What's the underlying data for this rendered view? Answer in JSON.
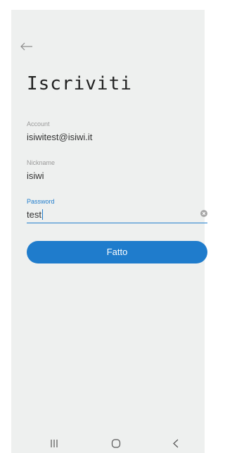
{
  "page": {
    "title": "Iscriviti"
  },
  "fields": {
    "account": {
      "label": "Account",
      "value": "isiwitest@isiwi.it"
    },
    "nickname": {
      "label": "Nickname",
      "value": "isiwi"
    },
    "password": {
      "label": "Password",
      "value": "test"
    }
  },
  "actions": {
    "done_label": "Fatto"
  },
  "icons": {
    "back": "arrow-left-icon",
    "clear": "clear-circle-icon",
    "nav_recents": "recents-icon",
    "nav_home": "home-icon",
    "nav_back": "chevron-left-icon"
  },
  "colors": {
    "accent": "#1f7ccc",
    "background": "#eef0ef",
    "text": "#222222",
    "label": "#9a9a9a"
  }
}
